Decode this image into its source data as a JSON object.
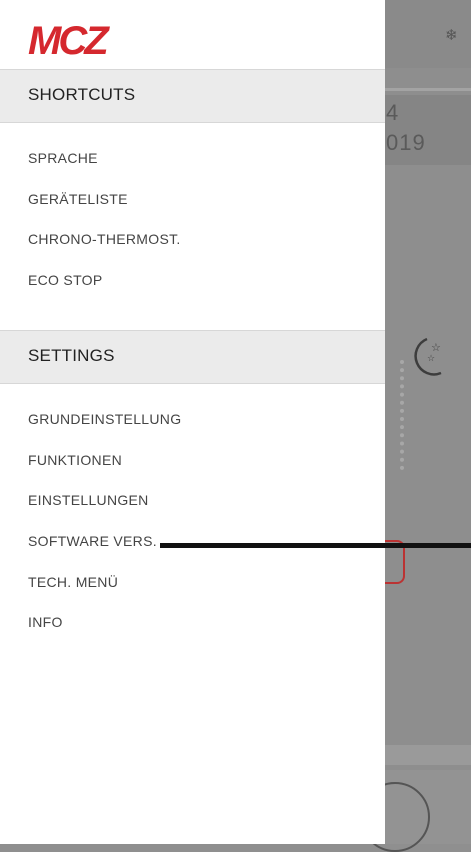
{
  "brand": {
    "logo_text": "MCZ",
    "logo_color": "#d5282e"
  },
  "background_app": {
    "partial_text_1": "4",
    "partial_text_2": "019",
    "icons": [
      "snowflake-icon",
      "moon-stars-icon",
      "hand-icon"
    ]
  },
  "drawer": {
    "shortcuts": {
      "title": "SHORTCUTS",
      "items": [
        "SPRACHE",
        "GERÄTELISTE",
        "CHRONO-THERMOST.",
        "ECO STOP"
      ]
    },
    "settings": {
      "title": "SETTINGS",
      "items": [
        "GRUNDEINSTELLUNG",
        "FUNKTIONEN",
        "EINSTELLUNGEN",
        "SOFTWARE VERS.",
        "TECH. MENÜ",
        "INFO"
      ]
    }
  }
}
